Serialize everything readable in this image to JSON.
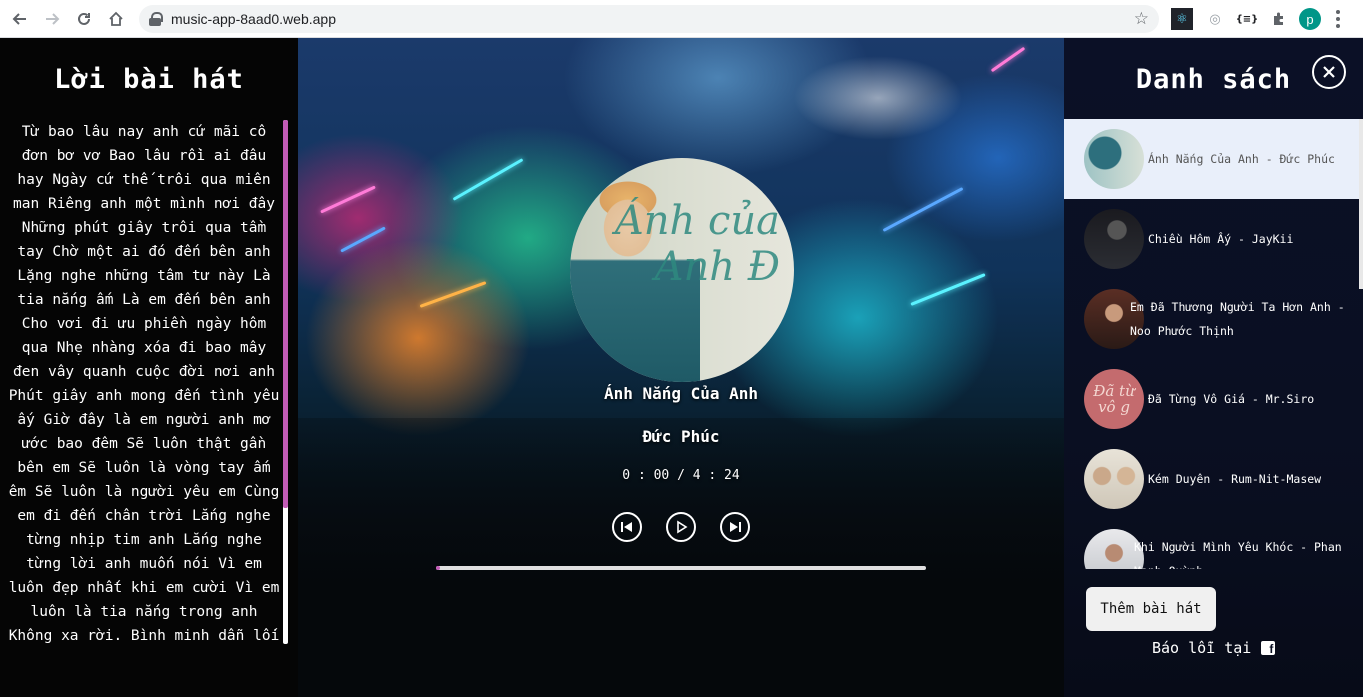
{
  "browser": {
    "url": "music-app-8aad0.web.app",
    "profile_initial": "p",
    "ext_json_label": "{≡}"
  },
  "lyrics": {
    "title": "Lời bài hát",
    "text": "Từ bao lâu nay anh cứ mãi cô đơn bơ vơ Bao lâu rồi ai đâu hay Ngày cứ thế trôi qua miên man Riêng anh một mình nơi đây Những phút giây trôi qua tầm tay Chờ một ai đó đến bên anh Lặng nghe những tâm tư này Là tia nắng ấm Là em đến bên anh Cho vơi đi ưu phiền ngày hôm qua Nhẹ nhàng xóa đi bao mây đen vây quanh cuộc đời nơi anh Phút giây anh mong đến tình yêu ấy Giờ đây là em người anh mơ ước bao đêm Sẽ luôn thật gần bên em Sẽ luôn là vòng tay ấm êm Sẽ luôn là người yêu em Cùng em đi đến chân trời Lắng nghe từng nhịp tim anh Lắng nghe từng lời anh muốn nói Vì em luôn đẹp nhất khi em cười Vì em luôn là tia nắng trong anh Không xa rời. Bình minh dẫn lối"
  },
  "player": {
    "disc_text": "Ánh của Anh Đ",
    "title": "Ánh Nắng Của Anh",
    "artist": "Đức Phúc",
    "time": "0 : 00 / 4 : 24",
    "progress": 0.008,
    "accent_color": "#c25bb6"
  },
  "playlist": {
    "title": "Danh sách",
    "items": [
      {
        "label": "Ánh Nắng Của Anh - Đức Phúc",
        "active": true
      },
      {
        "label": "Chiều Hôm Ấy - JayKii",
        "active": false
      },
      {
        "label": "Em Đã Thương Người Ta Hơn Anh - Noo Phước Thịnh",
        "active": false
      },
      {
        "label": "Đã Từng Vô Giá - Mr.Siro",
        "active": false
      },
      {
        "label": "Kém Duyên - Rum-Nit-Masew",
        "active": false
      },
      {
        "label": "Khi Người Mình Yêu Khóc - Phan Mạnh Quỳnh",
        "active": false
      }
    ],
    "thumb_text_4": "Đã từ vô g",
    "add_button": "Thêm bài hát",
    "report_text": "Báo lỗi tại",
    "report_icon": "f"
  }
}
